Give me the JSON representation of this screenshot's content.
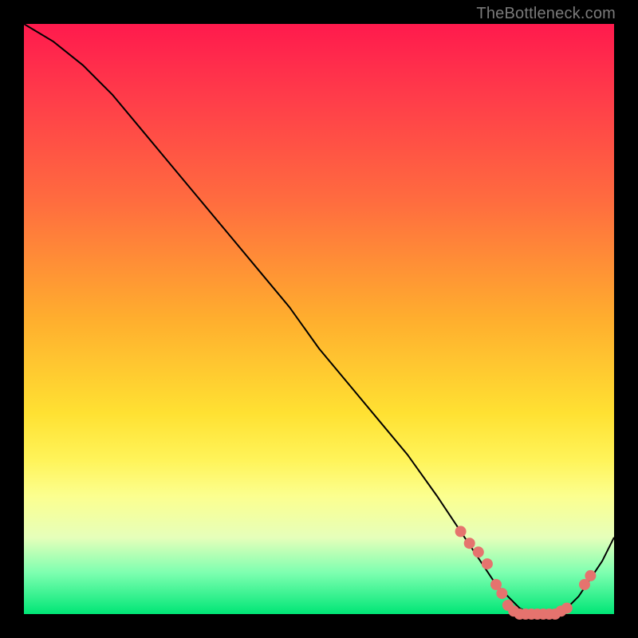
{
  "watermark": "TheBottleneck.com",
  "colors": {
    "background": "#000000",
    "gradient_top": "#ff1a4d",
    "gradient_bottom": "#00e676",
    "line": "#000000",
    "marker": "#e5736e"
  },
  "chart_data": {
    "type": "line",
    "title": "",
    "xlabel": "",
    "ylabel": "",
    "xlim": [
      0,
      100
    ],
    "ylim": [
      0,
      100
    ],
    "x": [
      0,
      5,
      10,
      15,
      20,
      25,
      30,
      35,
      40,
      45,
      50,
      55,
      60,
      65,
      70,
      72,
      74,
      76,
      78,
      80,
      82,
      84,
      86,
      88,
      90,
      92,
      94,
      96,
      98,
      100
    ],
    "values": [
      100,
      97,
      93,
      88,
      82,
      76,
      70,
      64,
      58,
      52,
      45,
      39,
      33,
      27,
      20,
      17,
      14,
      11,
      8,
      5,
      3,
      1,
      0,
      0,
      0,
      1,
      3,
      6,
      9,
      13
    ],
    "markers_x": [
      74,
      75.5,
      77,
      78.5,
      80,
      81,
      82,
      83,
      84,
      85,
      86,
      87,
      88,
      89,
      90,
      91,
      92,
      95,
      96
    ],
    "markers_y": [
      14,
      12,
      10.5,
      8.5,
      5,
      3.5,
      1.5,
      0.5,
      0,
      0,
      0,
      0,
      0,
      0,
      0,
      0.5,
      1,
      5,
      6.5
    ]
  }
}
